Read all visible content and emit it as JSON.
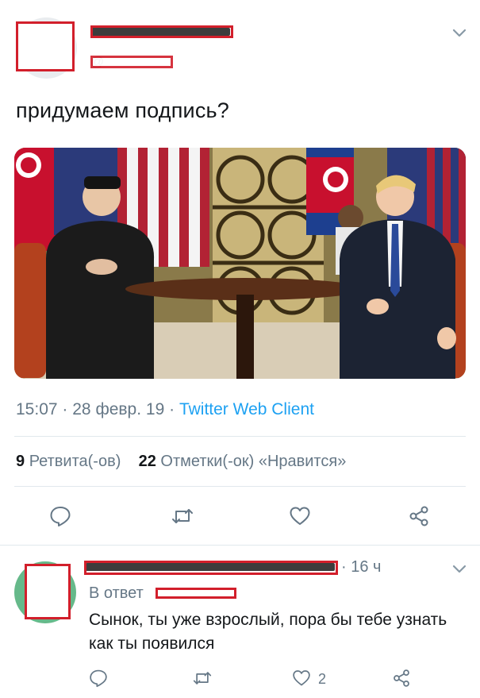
{
  "tweet": {
    "handle_prefix": "@",
    "text": "придумаем подпись?",
    "time": "15:07",
    "date": "28 февр. 19",
    "separator": "·",
    "client": "Twitter Web Client",
    "stats": {
      "retweets_count": "9",
      "retweets_label": "Ретвита(-ов)",
      "likes_count": "22",
      "likes_label": "Отметки(-ок) «Нравится»"
    }
  },
  "reply": {
    "time": "· 16 ч",
    "reply_to_label": "В ответ",
    "text": "Сынок, ты уже взрослый, пора бы тебе узнать как ты появился",
    "like_count": "2"
  },
  "icons": [
    "chevron-down-icon",
    "reply-icon",
    "retweet-icon",
    "heart-icon",
    "share-icon"
  ],
  "colors": {
    "accent": "#1da1f2",
    "secondary_text": "#657786",
    "redaction": "#d21f2b",
    "divider": "#e1e8ed"
  }
}
